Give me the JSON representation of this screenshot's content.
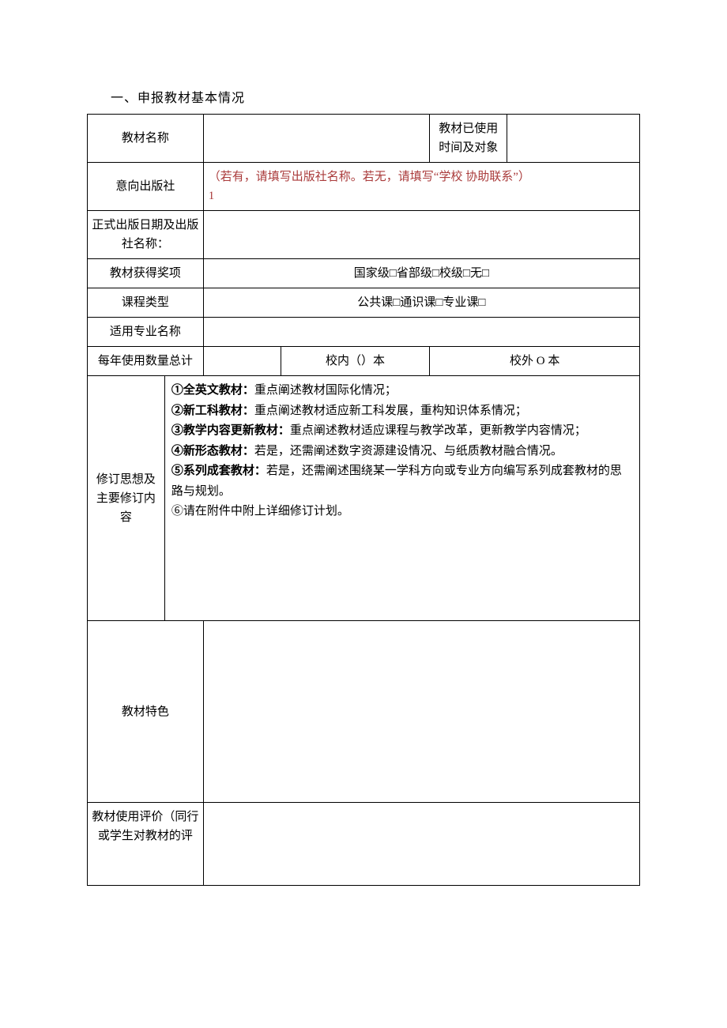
{
  "heading": "一、申报教材基本情况",
  "rows": {
    "r1_label": "教材名称",
    "r1_val": "",
    "r1_label2": "教材已使用时间及对象",
    "r1_val2": "",
    "r2_label": "意向出版社",
    "r2_hint": "（若有，请填写出版社名称。若无，请填写“学校 协助联系”）",
    "r2_num": "1",
    "r3_label": "正式出版日期及出版社名称：",
    "r3_val": "",
    "r4_label": "教材获得奖项",
    "r4_val": "国家级□省部级□校级□无□",
    "r5_label": "课程类型",
    "r5_val": "公共课□通识课□专业课□",
    "r6_label": "适用专业名称",
    "r6_val": "",
    "r7_label": "每年使用数量总计",
    "r7_val1": "",
    "r7_val2": "校内（）本",
    "r7_val3": "校外 O 本",
    "r8_label": "修订思想及主要修订内容",
    "r8_c1": "①全英文教材：",
    "r8_c1t": "重点阐述教材国际化情况；",
    "r8_c2": "②新工科教材：",
    "r8_c2t": "重点阐述教材适应新工科发展，重构知识体系情况；",
    "r8_c3": "③教学内容更新教材：",
    "r8_c3t": "重点阐述教材适应课程与教学改革，更新教学内容情况；",
    "r8_c4": "④新形态教材：",
    "r8_c4t": "若是，还需阐述数字资源建设情况、与纸质教材融合情况。",
    "r8_c5": "⑤系列成套教材：",
    "r8_c5t": "若是，还需阐述围绕某一学科方向或专业方向编写系列成套教材的思路与规划。",
    "r8_c6": "⑥请在附件中附上详细修订计划。",
    "r9_label": "教材特色",
    "r9_val": "",
    "r10_label": "教材使用评价（同行或学生对教材的评",
    "r10_val": ""
  }
}
